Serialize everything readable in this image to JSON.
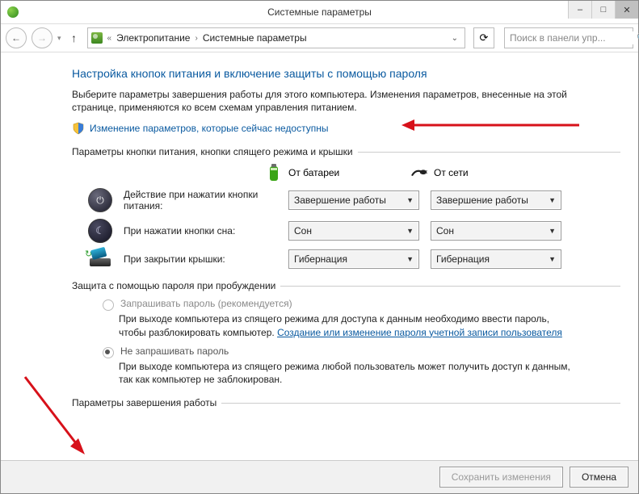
{
  "window": {
    "title": "Системные параметры",
    "minimize": "–",
    "maximize": "□",
    "close": "✕"
  },
  "nav": {
    "back": "←",
    "fwd": "→",
    "dd": "▾",
    "up": "↑",
    "refresh": "⟳"
  },
  "breadcrumb": {
    "a": "Электропитание",
    "b": "Системные параметры"
  },
  "search": {
    "placeholder": "Поиск в панели упр...",
    "icon": "🔍"
  },
  "heading": "Настройка кнопок питания и включение защиты с помощью пароля",
  "intro": "Выберите параметры завершения работы для этого компьютера. Изменения параметров, внесенные на этой странице, применяются ко всем схемам управления питанием.",
  "admin_link": "Изменение параметров, которые сейчас недоступны",
  "section_buttons": "Параметры кнопки питания, кнопки спящего режима и крышки",
  "cols": {
    "battery": "От батареи",
    "mains": "От сети"
  },
  "rows": {
    "power": {
      "label": "Действие при нажатии кнопки питания:",
      "battery": "Завершение работы",
      "mains": "Завершение работы"
    },
    "sleep": {
      "label": "При нажатии кнопки сна:",
      "battery": "Сон",
      "mains": "Сон"
    },
    "lid": {
      "label": "При закрытии крышки:",
      "battery": "Гибернация",
      "mains": "Гибернация"
    }
  },
  "section_pwd": "Защита с помощью пароля при пробуждении",
  "pwd": {
    "opt1_title": "Запрашивать пароль (рекомендуется)",
    "opt1_desc_a": "При выходе компьютера из спящего режима для доступа к данным необходимо ввести пароль, чтобы разблокировать компьютер. ",
    "opt1_link": "Создание или изменение пароля учетной записи пользователя",
    "opt2_title": "Не запрашивать пароль",
    "opt2_desc": "При выходе компьютера из спящего режима любой пользователь может получить доступ к данным, так как компьютер не заблокирован."
  },
  "section_shutdown": "Параметры завершения работы",
  "footer": {
    "save": "Сохранить изменения",
    "cancel": "Отмена"
  }
}
